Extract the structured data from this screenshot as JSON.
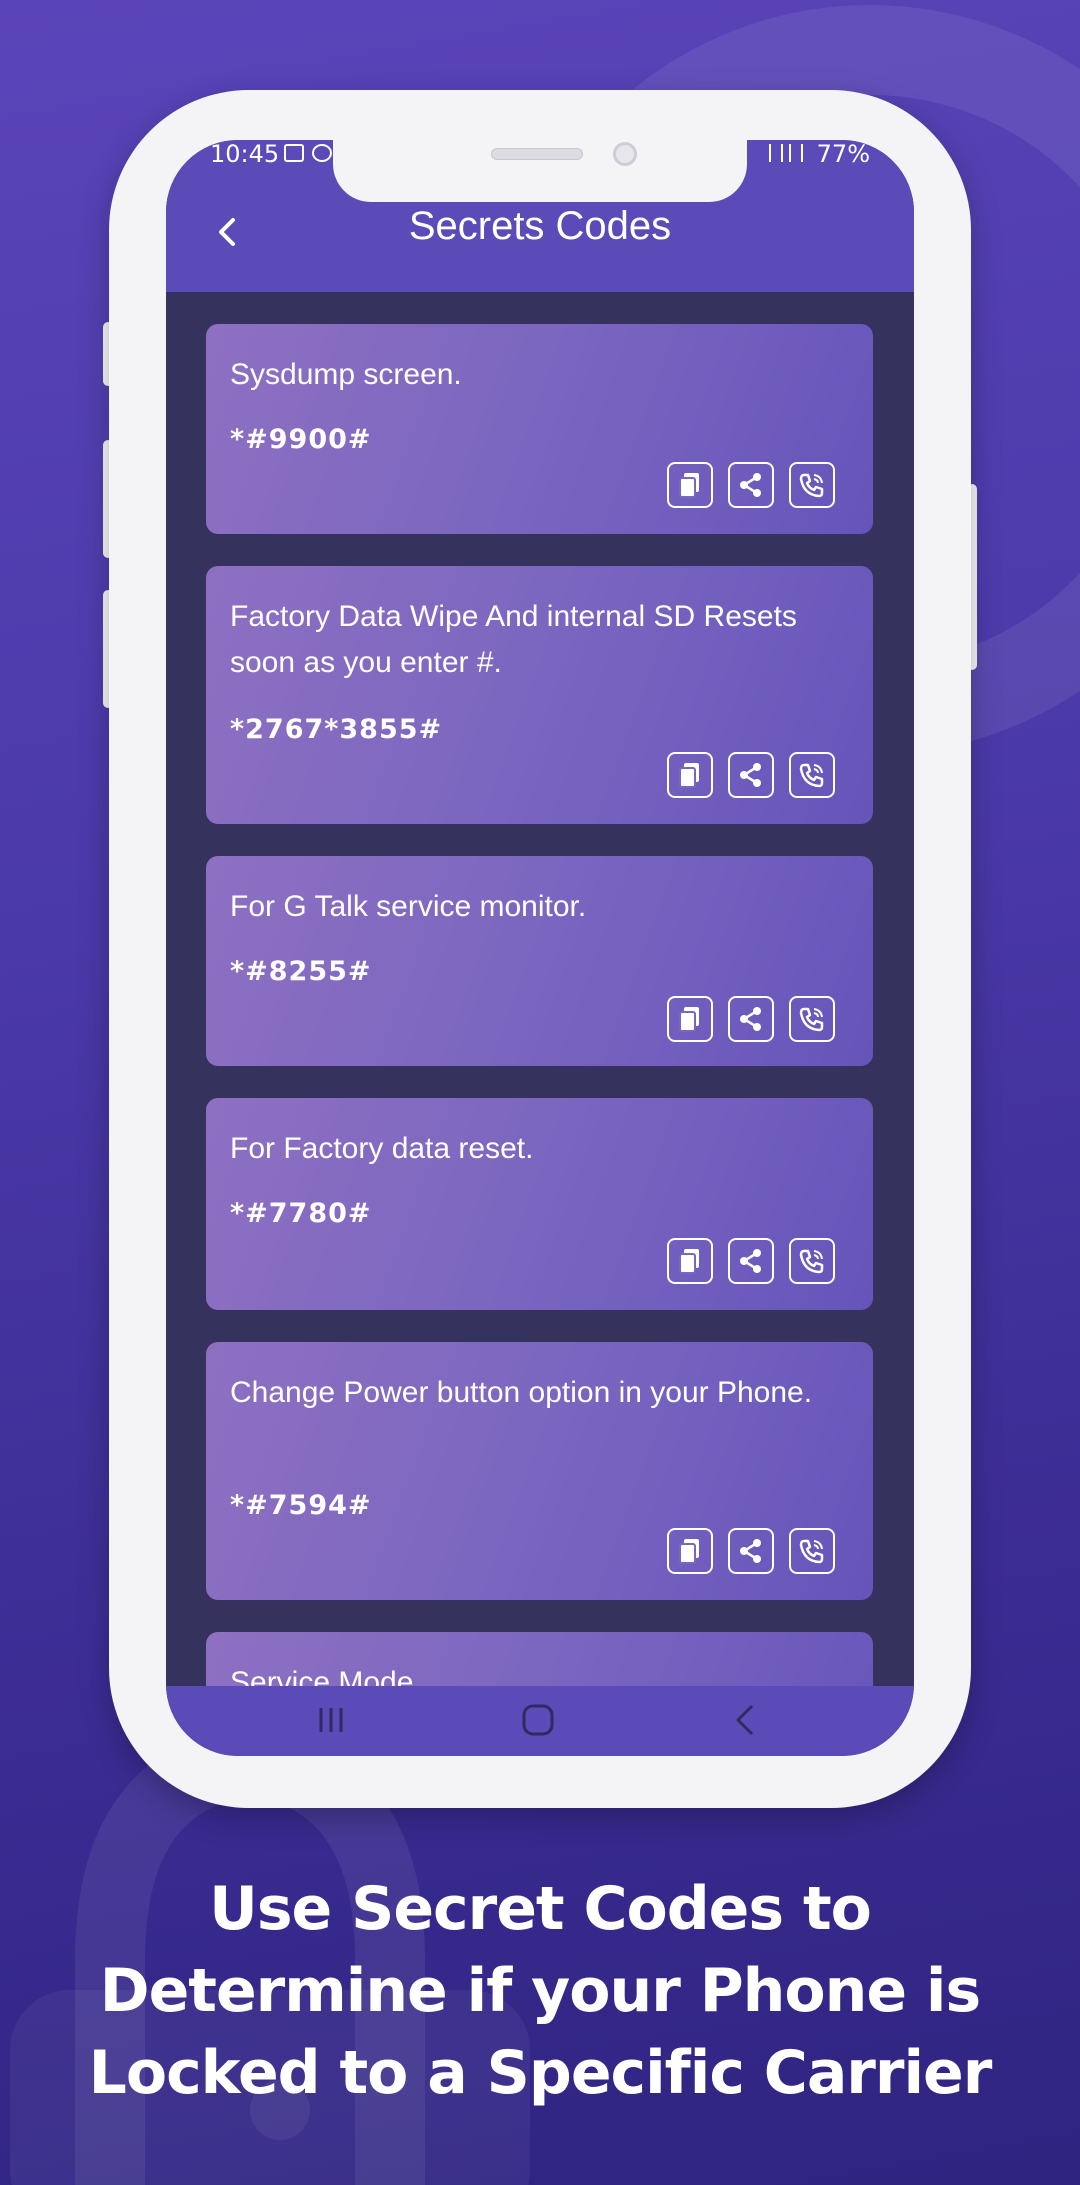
{
  "colors": {
    "background": "#4a39a8",
    "header": "#5b4bb9",
    "list_background": "#36325e",
    "card_start": "#8e70c2",
    "card_end": "#6654ba"
  },
  "status_bar": {
    "time": "10:45",
    "battery": "77%"
  },
  "header": {
    "back_icon": "chevron-left-icon",
    "title": "Secrets Codes"
  },
  "codes": [
    {
      "description": "Sysdump screen.",
      "code": "*#9900#"
    },
    {
      "description": "Factory Data Wipe And internal SD Resets soon as you enter #.",
      "code": "*2767*3855#"
    },
    {
      "description": "For G Talk service monitor.",
      "code": "*#8255#"
    },
    {
      "description": "For Factory data reset.",
      "code": "*#7780#"
    },
    {
      "description": "Change Power button option in your Phone.",
      "code": "*#7594#"
    },
    {
      "description": "Service Mode.",
      "code": ""
    }
  ],
  "card_actions": [
    "copy-icon",
    "share-icon",
    "call-icon"
  ],
  "navbar": [
    "recent-apps-icon",
    "home-icon",
    "back-icon"
  ],
  "caption": {
    "line1": "Use Secret Codes to",
    "line2": "Determine if your Phone is",
    "line3": "Locked to a Specific Carrier"
  }
}
